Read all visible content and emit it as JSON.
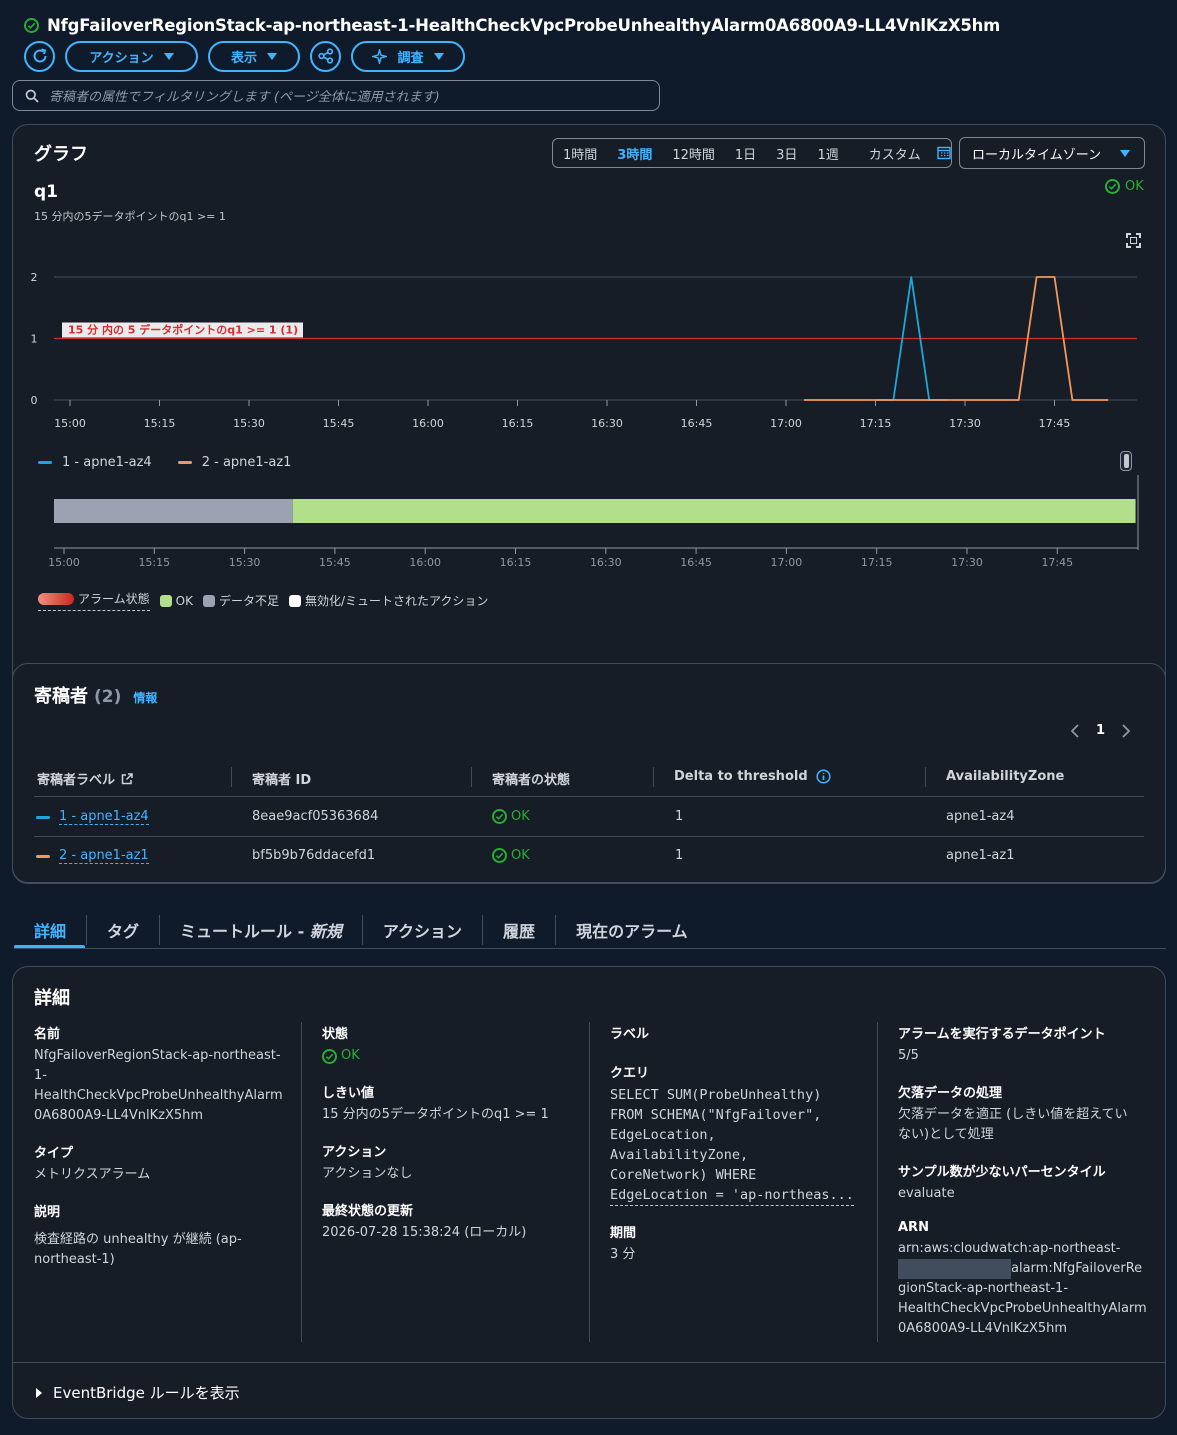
{
  "header": {
    "title": "NfgFailoverRegionStack-ap-northeast-1-HealthCheckVpcProbeUnhealthyAlarm0A6800A9-LL4VnlKzX5hm"
  },
  "toolbar": {
    "actions_label": "アクション",
    "view_label": "表示",
    "investigate_label": "調査"
  },
  "filter": {
    "placeholder": "寄稿者の属性でフィルタリングします (ページ全体に適用されます)"
  },
  "graph": {
    "heading": "グラフ",
    "ranges": [
      "1時間",
      "3時間",
      "12時間",
      "1日",
      "3日",
      "1週"
    ],
    "selected_range": "3時間",
    "custom_label": "カスタム",
    "timezone_label": "ローカルタイムゾーン",
    "metric_title": "q1",
    "metric_subtitle": "15 分内の5データポイントのq1 >= 1",
    "state_label": "OK",
    "threshold_label": "15 分 内の 5 データポイントのq1 >= 1 (1)",
    "legend_alarm": "アラーム状態",
    "legend_ok": "OK",
    "legend_insufficient": "データ不足",
    "legend_muted": "無効化/ミュートされたアクション",
    "colors": {
      "series1": "#1aa8d8",
      "series2": "#f5975a",
      "threshold": "#d62e2e",
      "ok_band": "#b2df8a",
      "insufficient_band": "#9ba3b3"
    }
  },
  "chart_data": {
    "type": "line",
    "x_ticks": [
      "15:00",
      "15:15",
      "15:30",
      "15:45",
      "16:00",
      "16:15",
      "16:30",
      "16:45",
      "17:00",
      "17:15",
      "17:30",
      "17:45"
    ],
    "y_ticks": [
      "0",
      "1",
      "2"
    ],
    "ylim": [
      0,
      2
    ],
    "xlim": [
      "14:57",
      "17:55"
    ],
    "threshold": 1,
    "grid": true,
    "legend_position": "bottom-left",
    "series": [
      {
        "name": "1 - apne1-az4",
        "color": "#1aa8d8",
        "points": [
          [
            "17:15",
            0
          ],
          [
            "17:18",
            0
          ],
          [
            "17:21",
            2
          ],
          [
            "17:24",
            0
          ],
          [
            "17:27",
            0
          ]
        ]
      },
      {
        "name": "2 - apne1-az1",
        "color": "#f5975a",
        "points": [
          [
            "17:03",
            0
          ],
          [
            "17:06",
            0
          ],
          [
            "17:09",
            0
          ],
          [
            "17:12",
            0
          ],
          [
            "17:15",
            0
          ],
          [
            "17:18",
            0
          ],
          [
            "17:21",
            0
          ],
          [
            "17:24",
            0
          ],
          [
            "17:27",
            0
          ],
          [
            "17:30",
            0
          ],
          [
            "17:33",
            0
          ],
          [
            "17:36",
            0
          ],
          [
            "17:39",
            0
          ],
          [
            "17:42",
            2
          ],
          [
            "17:45",
            2
          ],
          [
            "17:48",
            0
          ],
          [
            "17:51",
            0
          ],
          [
            "17:54",
            0
          ]
        ]
      }
    ],
    "state_timeline": {
      "x_ticks": [
        "15:00",
        "15:15",
        "15:30",
        "15:45",
        "16:00",
        "16:15",
        "16:30",
        "16:45",
        "17:00",
        "17:15",
        "17:30",
        "17:45"
      ],
      "segments": [
        {
          "state": "データ不足",
          "from": "14:58",
          "to": "15:38"
        },
        {
          "state": "OK",
          "from": "15:38",
          "to": "17:58"
        }
      ]
    }
  },
  "contributors": {
    "heading": "寄稿者",
    "count": "(2)",
    "info_label": "情報",
    "page": "1",
    "columns": [
      "寄稿者ラベル",
      "寄稿者 ID",
      "寄稿者の状態",
      "Delta to threshold",
      "AvailabilityZone"
    ],
    "rows": [
      {
        "label": "1 - apne1-az4",
        "id": "8eae9acf05363684",
        "state": "OK",
        "delta": "1",
        "az": "apne1-az4"
      },
      {
        "label": "2 - apne1-az1",
        "id": "bf5b9b76ddacefd1",
        "state": "OK",
        "delta": "1",
        "az": "apne1-az1"
      }
    ]
  },
  "tabs": {
    "details": "詳細",
    "tags": "タグ",
    "mute_rules": "ミュートルール - ",
    "mute_new": "新規",
    "actions": "アクション",
    "history": "履歴",
    "current_alarms": "現在のアラーム"
  },
  "details": {
    "heading": "詳細",
    "name_label": "名前",
    "name_lines": [
      "NfgFailoverRegionStack-ap-northeast-",
      "1-",
      "HealthCheckVpcProbeUnhealthyAlarm",
      "0A6800A9-LL4VnlKzX5hm"
    ],
    "type_label": "タイプ",
    "type_value": "メトリクスアラーム",
    "description_label": "説明",
    "description_lines": [
      "検査経路の unhealthy が継続 (ap-",
      "northeast-1)"
    ],
    "state_label": "状態",
    "state_value": "OK",
    "threshold_label": "しきい値",
    "threshold_value": "15 分内の5データポイントのq1 >= 1",
    "action_label": "アクション",
    "action_value": "アクションなし",
    "last_update_label": "最終状態の更新",
    "last_update_value": "2026-07-28 15:38:24 (ローカル)",
    "label_label": "ラベル",
    "query_label": "クエリ",
    "query_lines": [
      "SELECT SUM(ProbeUnhealthy)",
      "FROM SCHEMA(\"NfgFailover\",",
      "EdgeLocation,",
      "AvailabilityZone,",
      "CoreNetwork) WHERE",
      "EdgeLocation = 'ap-northeas..."
    ],
    "period_label": "期間",
    "period_value": "3 分",
    "datapoints_label": "アラームを実行するデータポイント",
    "datapoints_value": "5/5",
    "missing_label": "欠落データの処理",
    "missing_lines": [
      "欠落データを適正 (しきい値を超えてい",
      "ない)として処理"
    ],
    "percentile_label": "サンプル数が少ないパーセンタイル",
    "percentile_value": "evaluate",
    "arn_label": "ARN",
    "arn_lines": [
      "arn:aws:cloudwatch:ap-northeast-",
      "alarm:NfgFailoverRe",
      "gionStack-ap-northeast-1-",
      "HealthCheckVpcProbeUnhealthyAlarm",
      "0A6800A9-LL4VnlKzX5hm"
    ],
    "eventbridge_label": "EventBridge ルールを表示"
  }
}
